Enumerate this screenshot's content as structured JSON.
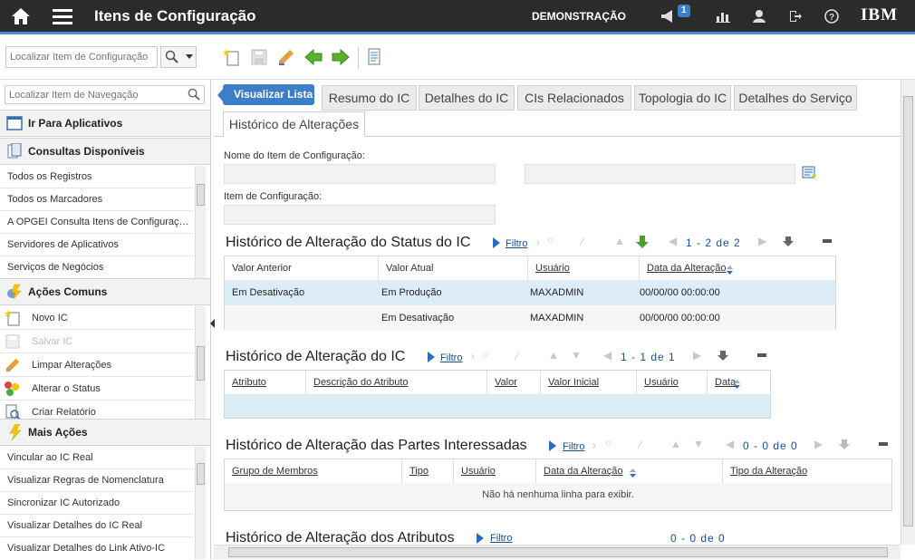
{
  "header": {
    "title": "Itens de Configuração",
    "environment": "DEMONSTRAÇÃO",
    "notification_count": "1",
    "brand": "IBM",
    "icons": [
      "home-icon",
      "menu-icon",
      "megaphone-icon",
      "chart-icon",
      "user-icon",
      "logout-icon",
      "help-icon"
    ]
  },
  "toolbar": {
    "search_placeholder": "Localizar Item de Configuração",
    "icons": [
      "new-record-icon",
      "save-icon",
      "clear-icon",
      "previous-icon",
      "next-icon",
      "report-icon"
    ]
  },
  "sidebar": {
    "search_placeholder": "Localizar Item de Navegação",
    "go_to_apps": "Ir Para Aplicativos",
    "queries_header": "Consultas Disponíveis",
    "queries": [
      "Todos os Registros",
      "Todos os Marcadores",
      "A OPGEI Consulta Itens de Configuraç…",
      "Servidores de Aplicativos",
      "Serviços de Negócios"
    ],
    "common_actions_header": "Ações Comuns",
    "common_actions": [
      {
        "label": "Novo IC",
        "icon": "new-ic-icon",
        "disabled": false
      },
      {
        "label": "Salvar IC",
        "icon": "save-ic-icon",
        "disabled": true
      },
      {
        "label": "Limpar Alterações",
        "icon": "clear-changes-icon",
        "disabled": false
      },
      {
        "label": "Alterar o Status",
        "icon": "change-status-icon",
        "disabled": false
      },
      {
        "label": "Criar Relatório",
        "icon": "create-report-icon",
        "disabled": false
      }
    ],
    "more_actions_header": "Mais Ações",
    "more_actions": [
      "Vincular ao IC Real",
      "Visualizar Regras de Nomenclatura",
      "Sincronizar IC Autorizado",
      "Visualizar Detalhes do IC Real",
      "Visualizar Detalhes do Link Ativo-IC"
    ]
  },
  "tabs": {
    "list": "Visualizar Lista",
    "items": [
      "Resumo do IC",
      "Detalhes do IC",
      "CIs Relacionados",
      "Topologia do IC",
      "Detalhes do Serviço"
    ],
    "active": "Histórico de Alterações"
  },
  "form": {
    "ci_name_label": "Nome do Item de Configuração:",
    "ci_label": "Item de Configuração:"
  },
  "status_history": {
    "title": "Histórico de Alteração do Status do IC",
    "filter": "Filtro",
    "pagination": "1 - 2 de 2",
    "columns": [
      "Valor Anterior",
      "Valor Atual",
      "Usuário",
      "Data da Alteração"
    ],
    "rows": [
      [
        "Em Desativação",
        "Em Produção",
        "MAXADMIN",
        "00/00/00 00:00:00"
      ],
      [
        "",
        "Em Desativação",
        "MAXADMIN",
        "00/00/00 00:00:00"
      ]
    ]
  },
  "ci_history": {
    "title": "Histórico de Alteração do IC",
    "filter": "Filtro",
    "pagination": "1 - 1 de 1",
    "columns": [
      "Atributo",
      "Descrição do Atributo",
      "Valor",
      "Valor Inicial",
      "Usuário",
      "Data"
    ]
  },
  "parties_history": {
    "title": "Histórico de Alteração das Partes Interessadas",
    "filter": "Filtro",
    "pagination": "0 - 0 de 0",
    "columns": [
      "Grupo de Membros",
      "Tipo",
      "Usuário",
      "Data da Alteração",
      "Tipo da Alteração"
    ],
    "empty": "Não há nenhuma linha para exibir."
  },
  "attr_history": {
    "title": "Histórico de Alteração dos Atributos",
    "filter": "Filtro",
    "pagination": "0 - 0 de 0"
  }
}
